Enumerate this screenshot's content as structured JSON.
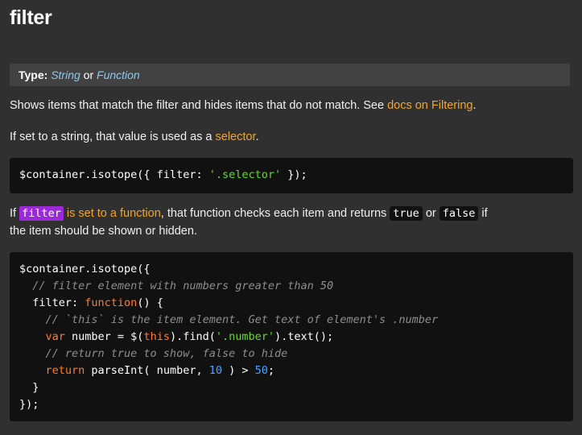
{
  "title": "filter",
  "type": {
    "label": "Type:",
    "t1": "String",
    "or": "or",
    "t2": "Function"
  },
  "p1": {
    "text": "Shows items that match the filter and hides items that do not match. See ",
    "link": "docs on Filtering",
    "end": "."
  },
  "p2": {
    "text": "If set to a string, that value is used as a ",
    "link": "selector",
    "end": "."
  },
  "code1": {
    "a": "$container.isotope({ filter: ",
    "str": "'.selector'",
    "b": " });"
  },
  "p3": {
    "if": "If ",
    "code": "filter",
    "hl": " is set to a function",
    "mid": ", that function checks each item and returns ",
    "t": "true",
    "or": " or ",
    "f": "false",
    "end": " if",
    "line2": "the item should be shown or hidden."
  },
  "code2": {
    "l1": "$container.isotope({",
    "l2": "  // filter element with numbers greater than 50",
    "l3a": "  filter: ",
    "l3k": "function",
    "l3b": "() {",
    "l4": "    // `this` is the item element. Get text of element's .number",
    "l5k": "    var",
    "l5a": " number = $(",
    "l5t": "this",
    "l5b": ").find(",
    "l5s": "'.number'",
    "l5c": ").text();",
    "l6": "    // return true to show, false to hide",
    "l7k": "    return",
    "l7a": " parseInt( number, ",
    "l7n1": "10",
    "l7b": " ) > ",
    "l7n2": "50",
    "l7c": ";",
    "l8": "  }",
    "l9": "});"
  }
}
